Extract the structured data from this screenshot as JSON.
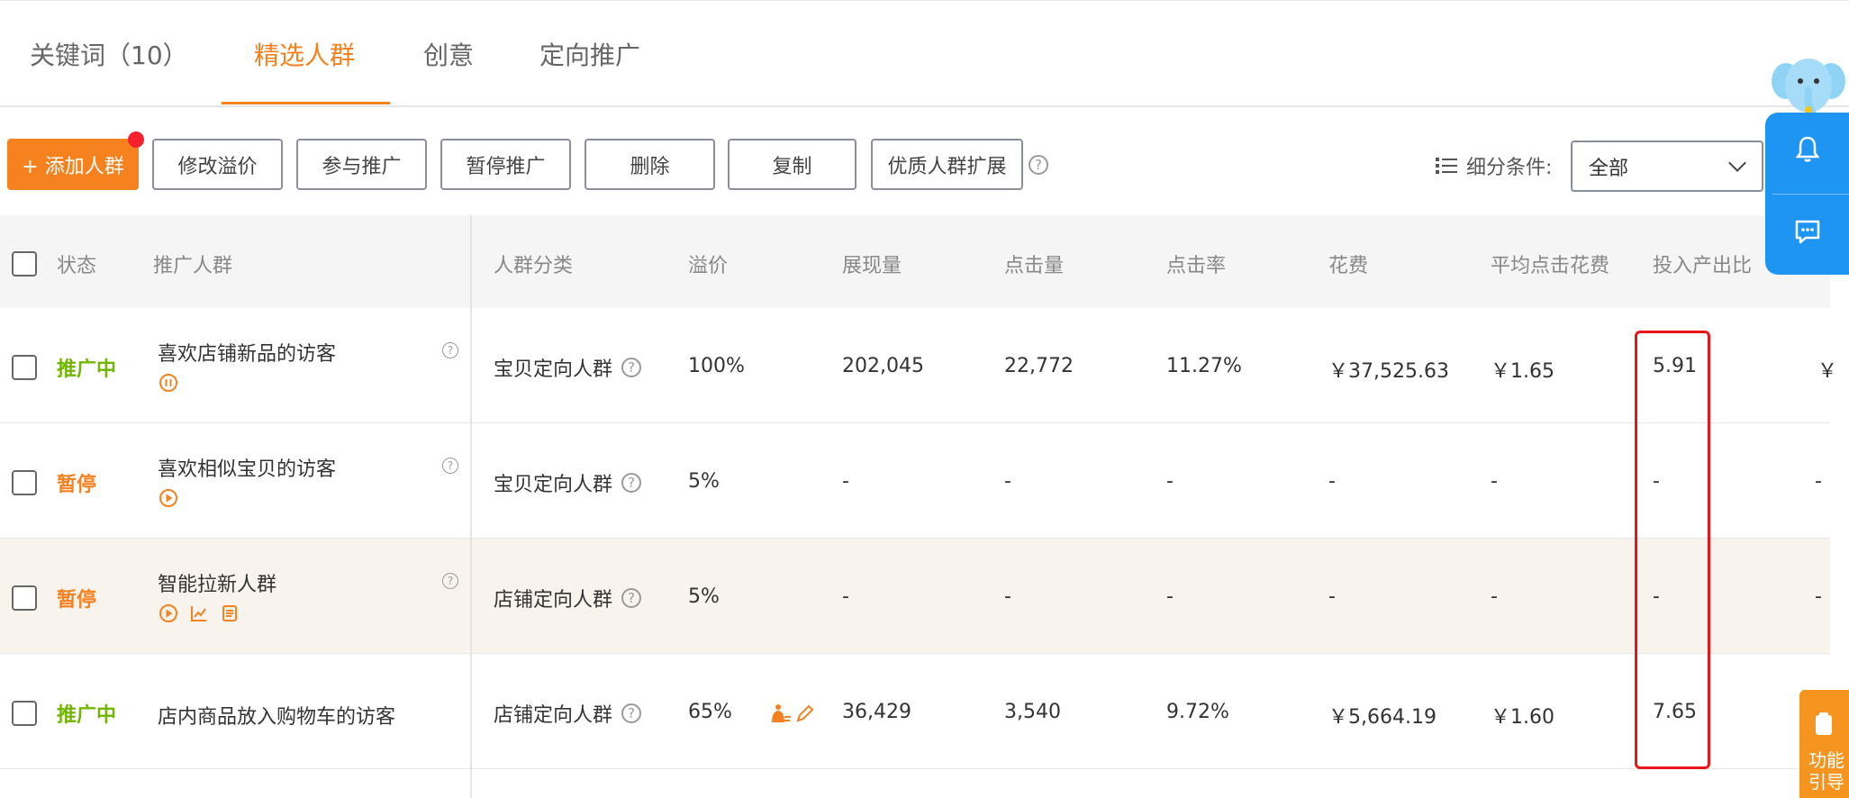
{
  "tabs": [
    {
      "label": "关键词（10）"
    },
    {
      "label": "精选人群",
      "active": true
    },
    {
      "label": "创意"
    },
    {
      "label": "定向推广"
    }
  ],
  "toolbar": {
    "add": "+ 添加人群",
    "modify": "修改溢价",
    "join": "参与推广",
    "pause": "暂停推广",
    "delete": "删除",
    "copy": "复制",
    "expand": "优质人群扩展",
    "help": "?",
    "filter_label": "细分条件:",
    "filter_value": "全部"
  },
  "table": {
    "headers": {
      "status": "状态",
      "crowd": "推广人群",
      "category": "人群分类",
      "premium": "溢价",
      "impressions": "展现量",
      "clicks": "点击量",
      "ctr": "点击率",
      "cost": "花费",
      "cpc": "平均点击花费",
      "roi": "投入产出比"
    },
    "rows": [
      {
        "status": "推广中",
        "name": "喜欢店铺新品的访客",
        "category": "宝贝定向人群",
        "premium": "100%",
        "impressions": "202,045",
        "clicks": "22,772",
        "ctr": "11.27%",
        "cost": "￥37,525.63",
        "cpc": "￥1.65",
        "roi": "5.91",
        "extra": "￥"
      },
      {
        "status": "暂停",
        "name": "喜欢相似宝贝的访客",
        "category": "宝贝定向人群",
        "premium": "5%",
        "impressions": "-",
        "clicks": "-",
        "ctr": "-",
        "cost": "-",
        "cpc": "-",
        "roi": "-",
        "extra": "-"
      },
      {
        "status": "暂停",
        "name": "智能拉新人群",
        "category": "店铺定向人群",
        "premium": "5%",
        "impressions": "-",
        "clicks": "-",
        "ctr": "-",
        "cost": "-",
        "cpc": "-",
        "roi": "-",
        "extra": "-"
      },
      {
        "status": "推广中",
        "name": "店内商品放入购物车的访客",
        "category": "店铺定向人群",
        "premium": "65%",
        "impressions": "36,429",
        "clicks": "3,540",
        "ctr": "9.72%",
        "cost": "￥5,664.19",
        "cpc": "￥1.60",
        "roi": "7.65",
        "extra": ""
      }
    ]
  },
  "side": {
    "guide_label": "功能引导"
  },
  "colors": {
    "accent": "#f5811f",
    "active_status": "#72b500",
    "float_blue": "#1e95f2",
    "highlight_box": "#e8161b"
  }
}
